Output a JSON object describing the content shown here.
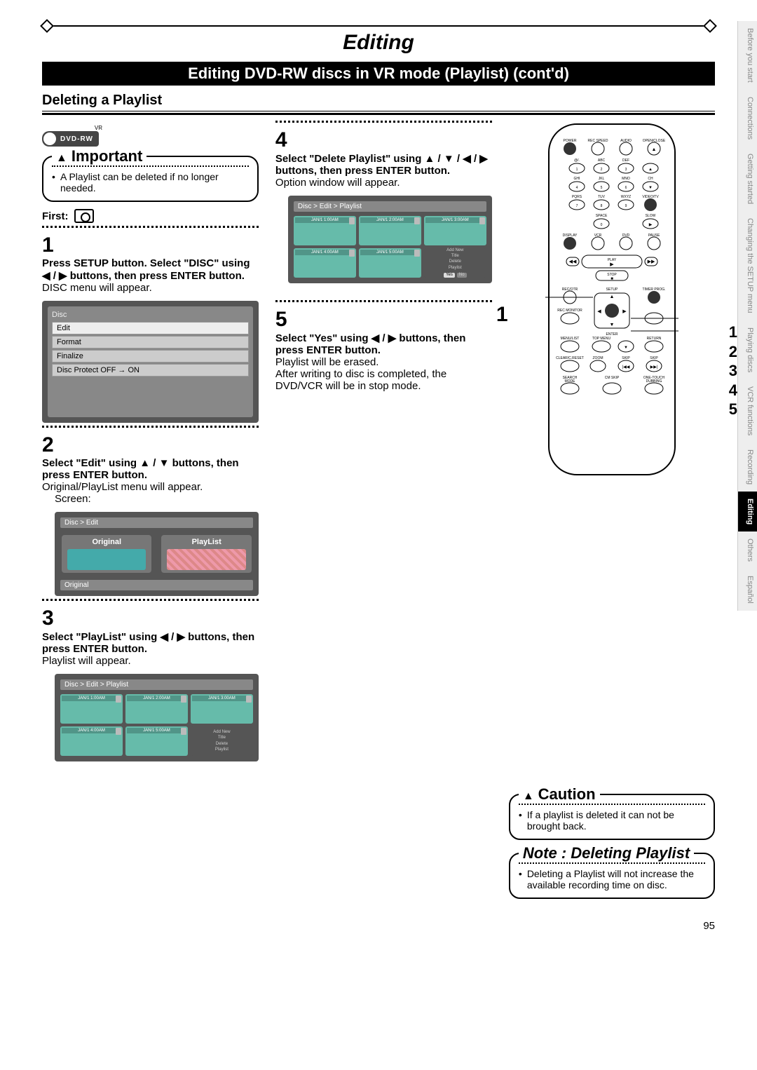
{
  "page_title": "Editing",
  "subtitle": "Editing DVD-RW discs in VR mode (Playlist) (cont'd)",
  "section": "Deleting a Playlist",
  "dvd_badge": {
    "text": "DVD-RW",
    "top": "VR"
  },
  "important": {
    "title": "Important",
    "body": "A Playlist can be deleted if no longer needed."
  },
  "first_label": "First:",
  "steps": {
    "s1": {
      "num": "1",
      "title": "Press SETUP button. Select \"DISC\" using ◀ / ▶ buttons, then press ENTER button.",
      "body": "DISC menu will appear."
    },
    "disc_menu": {
      "header": "Disc",
      "rows": [
        "Edit",
        "Format",
        "Finalize",
        "Disc Protect OFF → ON"
      ]
    },
    "s2": {
      "num": "2",
      "title": "Select \"Edit\" using ▲ / ▼ buttons, then press ENTER button.",
      "body": "Original/PlayList menu will appear.",
      "screen_label": "Screen:"
    },
    "edit_menu": {
      "breadcrumb": "Disc > Edit",
      "opt1": "Original",
      "opt2": "PlayList",
      "footer": "Original"
    },
    "s3": {
      "num": "3",
      "title": "Select \"PlayList\" using ◀ / ▶ buttons, then press ENTER button.",
      "body": "Playlist will appear."
    },
    "playlist_screen": {
      "breadcrumb": "Disc > Edit > Playlist",
      "cells": [
        "JAN/1  1:00AM",
        "JAN/1  2:00AM",
        "JAN/1  3:00AM",
        "JAN/1  4:00AM",
        "JAN/1  5:00AM"
      ],
      "menu": [
        "Add New",
        "Title",
        "Delete",
        "Playlist"
      ]
    },
    "s4": {
      "num": "4",
      "title": "Select \"Delete Playlist\" using ▲ / ▼ / ◀ / ▶ buttons, then press ENTER button.",
      "body": "Option window will appear."
    },
    "playlist_screen2": {
      "breadcrumb": "Disc > Edit > Playlist",
      "cells": [
        "JAN/1  1:00AM",
        "JAN/1  2:00AM",
        "JAN/1  3:00AM",
        "JAN/1  4:00AM",
        "JAN/1  5:00AM"
      ],
      "menu": [
        "Add New",
        "Title",
        "Delete",
        "Playlist"
      ],
      "yes": "Yes",
      "no": "No"
    },
    "s5": {
      "num": "5",
      "title": "Select \"Yes\" using ◀ / ▶ buttons, then press ENTER button.",
      "body": "Playlist will be erased.\nAfter writing to disc is completed, the DVD/VCR will be in stop mode."
    }
  },
  "remote": {
    "left_num": "1",
    "right_nums": [
      "1",
      "2",
      "3",
      "4",
      "5"
    ],
    "labels": {
      "row1": [
        "POWER",
        "REC SPEED",
        "AUDIO",
        "OPEN/CLOSE"
      ],
      "row2": [
        "@/.",
        "ABC",
        "DEF"
      ],
      "row3": [
        "1",
        "2",
        "3"
      ],
      "row4": [
        "GHI",
        "JKL",
        "MNO",
        "CH"
      ],
      "row5": [
        "4",
        "5",
        "6"
      ],
      "row6": [
        "PQRS",
        "TUV",
        "WXYZ",
        "VIDEO/TV"
      ],
      "row7": [
        "7",
        "8",
        "9"
      ],
      "row8": [
        "SPACE",
        "",
        "SLOW"
      ],
      "row9": [
        "0"
      ],
      "row10": [
        "DISPLAY",
        "VCR",
        "DVD",
        "PAUSE"
      ],
      "row11": [
        "PLAY",
        "STOP"
      ],
      "row12": [
        "REC/OTR",
        "SETUP",
        "TIMER PROG."
      ],
      "row13": [
        "REC MONITOR",
        "ENTER"
      ],
      "row14": [
        "MENU/LIST",
        "TOP MENU",
        "RETURN"
      ],
      "row15": [
        "CLEAR/C.RESET",
        "ZOOM",
        "SKIP",
        "SKIP"
      ],
      "row16": [
        "SEARCH MODE",
        "CM SKIP",
        "ONE-TOUCH DUBBING"
      ]
    }
  },
  "caution": {
    "title": "Caution",
    "body": "If a playlist is deleted it can not be brought back."
  },
  "note": {
    "title": "Note : Deleting Playlist",
    "body": "Deleting a Playlist will not increase the available recording time on disc."
  },
  "side_tabs": [
    "Before you start",
    "Connections",
    "Getting started",
    "Changing the SETUP menu",
    "Playing discs",
    "VCR functions",
    "Recording",
    "Editing",
    "Others",
    "Español"
  ],
  "page_number": "95"
}
